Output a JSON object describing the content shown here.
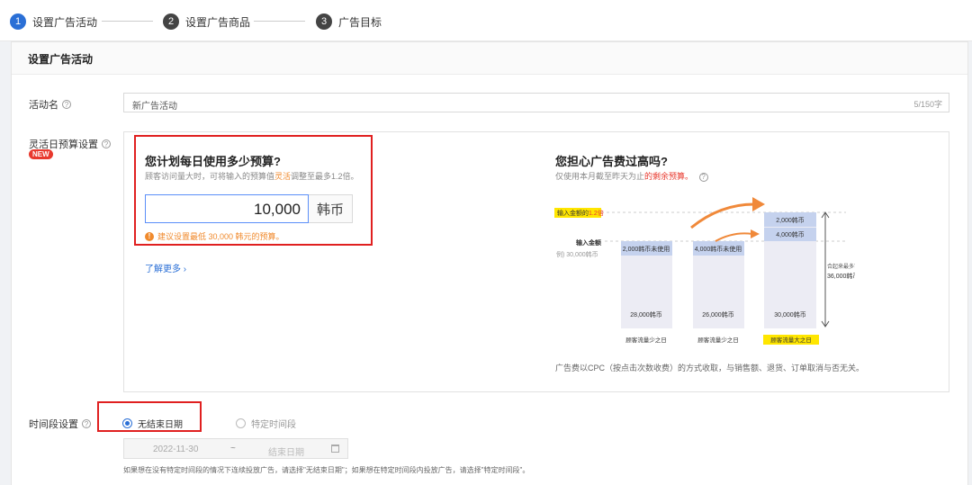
{
  "steps": [
    {
      "num": "1",
      "label": "设置广告活动",
      "color": "#2a6fd6"
    },
    {
      "num": "2",
      "label": "设置广告商品",
      "color": "#444444"
    },
    {
      "num": "3",
      "label": "广告目标",
      "color": "#444444"
    }
  ],
  "card": {
    "title": "设置广告活动"
  },
  "campaign": {
    "label": "活动名",
    "value": "新广告活动",
    "counter": "5/150字"
  },
  "budget": {
    "label": "灵活日预算设置",
    "badge": "NEW",
    "question": "您计划每日使用多少预算?",
    "hint_pre": "顾客访问量大时，可将输入的预算值",
    "hint_hl": "灵活",
    "hint_post": "调整至最多1.2倍。",
    "amount": "10,000",
    "unit": "韩币",
    "warning": "建议设置最低 30,000 韩元的预算。",
    "learn_more": "了解更多",
    "concern_title": "您担心广告费过高吗?",
    "concern_sub_pre": "仅使用本月截至昨天为止",
    "concern_sub_hl": "的剩余预算。",
    "footnote": "广告费以CPC（按点击次数收费）的方式收取，与销售额、退货、订单取消与否无关。"
  },
  "illustration": {
    "max_label_pre": "输入金额的",
    "max_label_hl": "1.2倍",
    "input_label": "输入金额",
    "input_sub": "例) 30,000韩币",
    "total_label": "合起来最多可使用",
    "total_value": "36,000韩币",
    "cols": [
      {
        "top": "2,000韩币未使用",
        "bottom": "28,000韩币",
        "day": "顾客流量少之日",
        "highlight": false
      },
      {
        "top": "4,000韩币未使用",
        "bottom": "26,000韩币",
        "day": "顾客流量少之日",
        "highlight": false
      },
      {
        "top": "2,000韩币",
        "mid": "4,000韩币",
        "bottom": "30,000韩币",
        "day": "顾客流量大之日",
        "highlight": true
      }
    ],
    "colors": {
      "bar": "#ececf4",
      "bar_top": "#c5d2ee",
      "arrow": "#f0893a",
      "yellow": "#ffe600"
    }
  },
  "time": {
    "label": "时间段设置",
    "opt1": "无结束日期",
    "opt2": "特定时间段",
    "start": "2022-11-30",
    "sep": "~",
    "end": "结束日期",
    "note": "如果想在没有特定时间段的情况下连续投放广告，请选择\"无结束日期\"；如果想在特定时间段内投放广告，请选择\"特定时间段\"。"
  }
}
